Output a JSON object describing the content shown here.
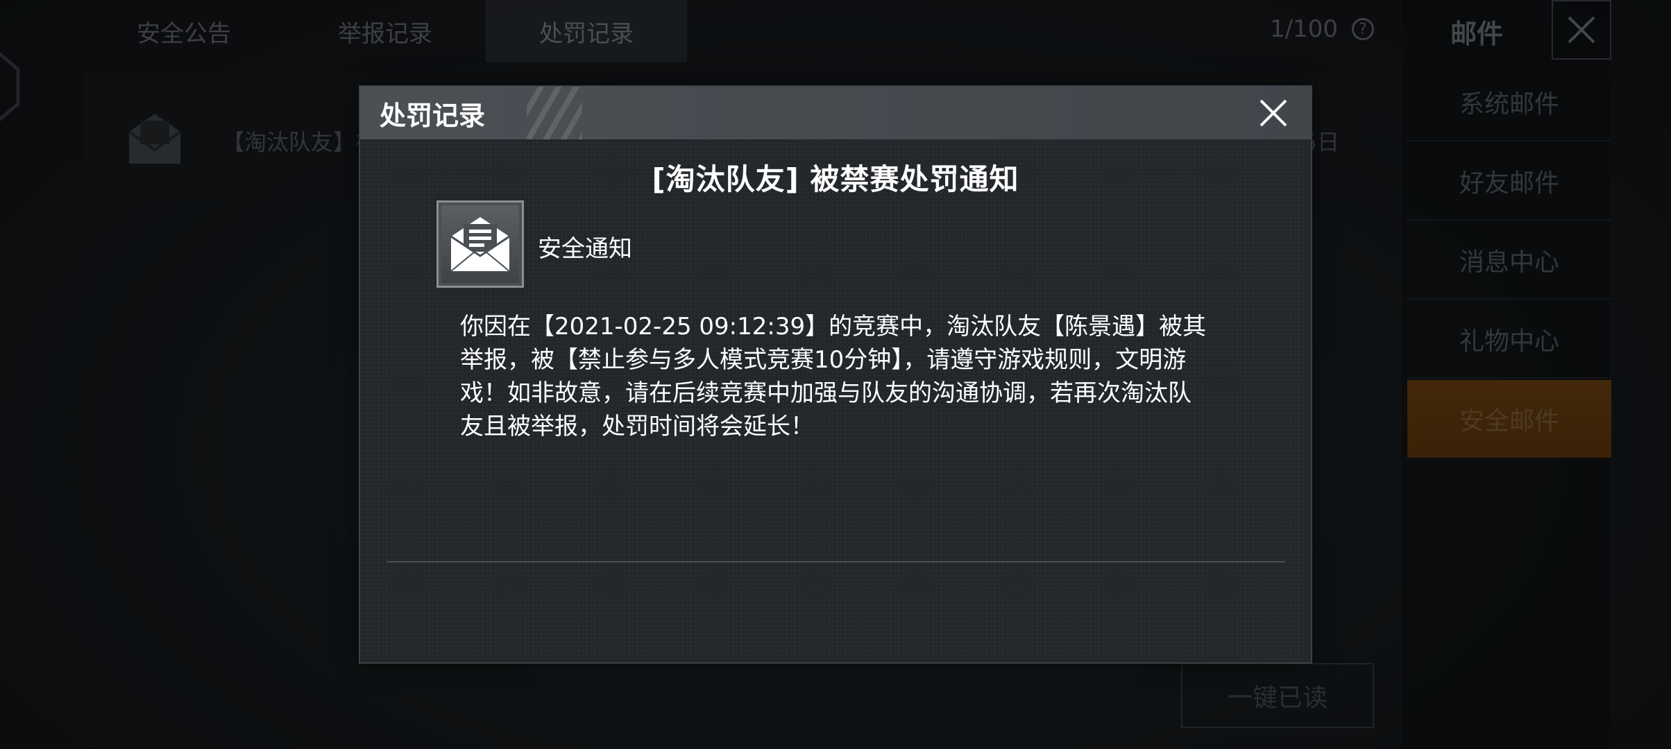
{
  "tabs": [
    {
      "label": "安全公告",
      "active": false
    },
    {
      "label": "举报记录",
      "active": false
    },
    {
      "label": "处罚记录",
      "active": true
    }
  ],
  "counter": {
    "text": "1/100",
    "help_glyph": "?"
  },
  "mail_list": {
    "item_title": "【淘汰队友】被",
    "item_date": "5日"
  },
  "sidebar": {
    "title": "邮件",
    "items": [
      {
        "label": "系统邮件",
        "active": false
      },
      {
        "label": "好友邮件",
        "active": false
      },
      {
        "label": "消息中心",
        "active": false
      },
      {
        "label": "礼物中心",
        "active": false
      },
      {
        "label": "安全邮件",
        "active": true
      }
    ]
  },
  "bottom": {
    "mark_all_read": "一键已读"
  },
  "modal": {
    "header_title": "处罚记录",
    "notice_title": "[淘汰队友] 被禁赛处罚通知",
    "sender": "安全通知",
    "body": "你因在【2021-02-25 09:12:39】的竞赛中，淘汰队友【陈景遇】被其举报，被【禁止参与多人模式竞赛10分钟】，请遵守游戏规则，文明游戏！如非故意，请在后续竞赛中加强与队友的沟通协调，若再次淘汰队友且被举报，处罚时间将会延长！"
  },
  "colors": {
    "accent_active": "#7a4a12",
    "modal_bg": "#23272b",
    "header_bg": "#4b5055"
  }
}
